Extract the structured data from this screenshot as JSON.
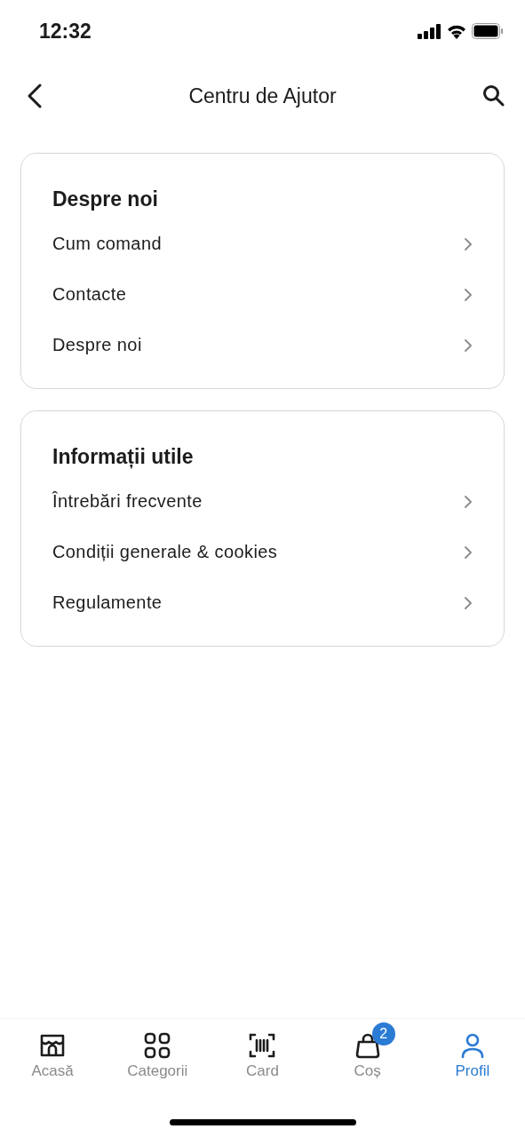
{
  "status_bar": {
    "time": "12:32"
  },
  "header": {
    "title": "Centru de Ajutor"
  },
  "sections": [
    {
      "title": "Despre noi",
      "items": [
        "Cum comand",
        "Contacte",
        "Despre noi"
      ]
    },
    {
      "title": "Informații utile",
      "items": [
        "Întrebări frecvente",
        "Condiții generale & cookies",
        "Regulamente"
      ]
    }
  ],
  "tab_bar": [
    {
      "kind": "store",
      "label": "Acasă",
      "selected": false
    },
    {
      "kind": "grid",
      "label": "Categorii",
      "selected": false
    },
    {
      "kind": "barcode",
      "label": "Card",
      "selected": false
    },
    {
      "kind": "bag",
      "label": "Coș",
      "selected": false,
      "badge": "2"
    },
    {
      "kind": "person",
      "label": "Profil",
      "selected": true
    }
  ]
}
